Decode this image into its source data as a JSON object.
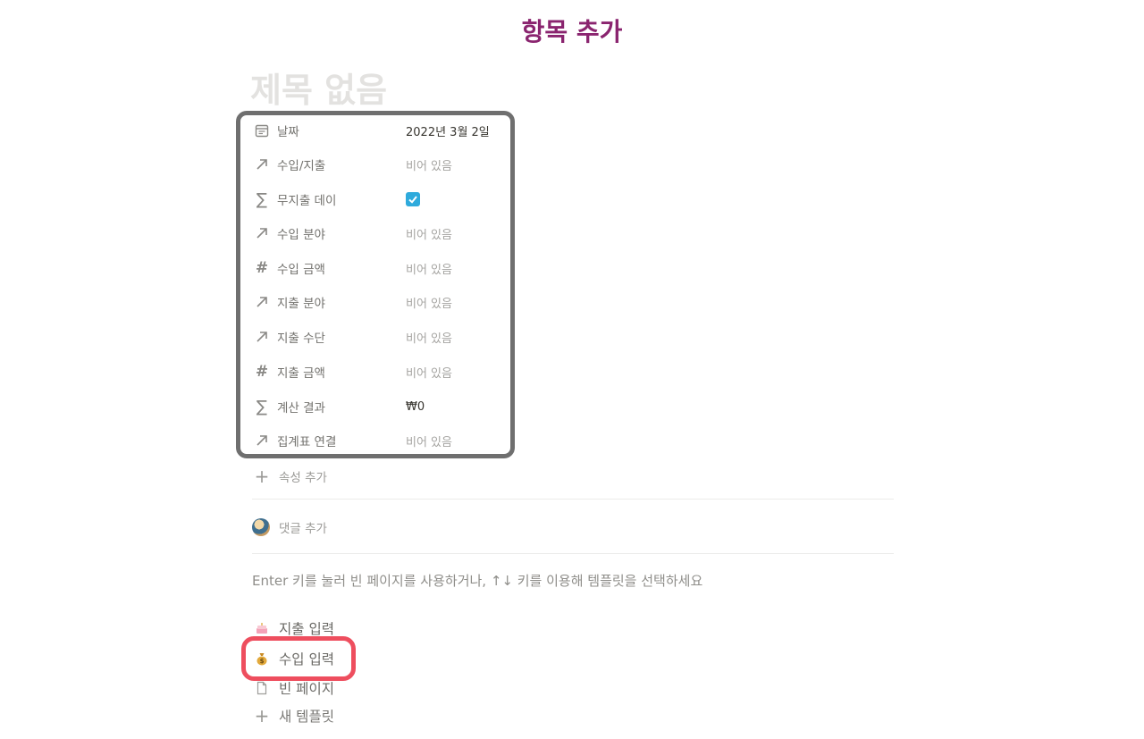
{
  "heading": "항목 추가",
  "page": {
    "title_placeholder": "제목 없음"
  },
  "properties": [
    {
      "icon": "calendar-icon",
      "name": "날짜",
      "value": "2022년 3월 2일",
      "filled": true
    },
    {
      "icon": "relation-arrow-icon",
      "name": "수입/지출",
      "value": "비어 있음"
    },
    {
      "icon": "formula-sigma-icon",
      "name": "무지출 데이",
      "value": "checked",
      "checkbox": true
    },
    {
      "icon": "relation-arrow-icon",
      "name": "수입 분야",
      "value": "비어 있음"
    },
    {
      "icon": "number-hash-icon",
      "name": "수입 금액",
      "value": "비어 있음"
    },
    {
      "icon": "relation-arrow-icon",
      "name": "지출 분야",
      "value": "비어 있음"
    },
    {
      "icon": "relation-arrow-icon",
      "name": "지출 수단",
      "value": "비어 있음"
    },
    {
      "icon": "number-hash-icon",
      "name": "지출 금액",
      "value": "비어 있음"
    },
    {
      "icon": "formula-sigma-icon",
      "name": "계산 결과",
      "value": "₩0",
      "filled": true
    },
    {
      "icon": "relation-arrow-icon",
      "name": "집계표 연결",
      "value": "비어 있음"
    }
  ],
  "add_property_label": "속성 추가",
  "add_comment_label": "댓글 추가",
  "hint_text": "Enter 키를 눌러 빈 페이지를 사용하거나, ↑↓ 키를 이용해 템플릿을 선택하세요",
  "templates": [
    {
      "icon": "cake-icon",
      "label": "지출 입력"
    },
    {
      "icon": "money-bag-icon",
      "label": "수입 입력"
    },
    {
      "icon": "blank-page-icon",
      "label": "빈 페이지"
    },
    {
      "icon": "plus-icon",
      "label": "새 템플릿"
    }
  ],
  "colors": {
    "heading": "#8a246f",
    "highlight": "#ee4e5e",
    "box_border": "#6f6f6f",
    "checkbox": "#2eaadc"
  }
}
